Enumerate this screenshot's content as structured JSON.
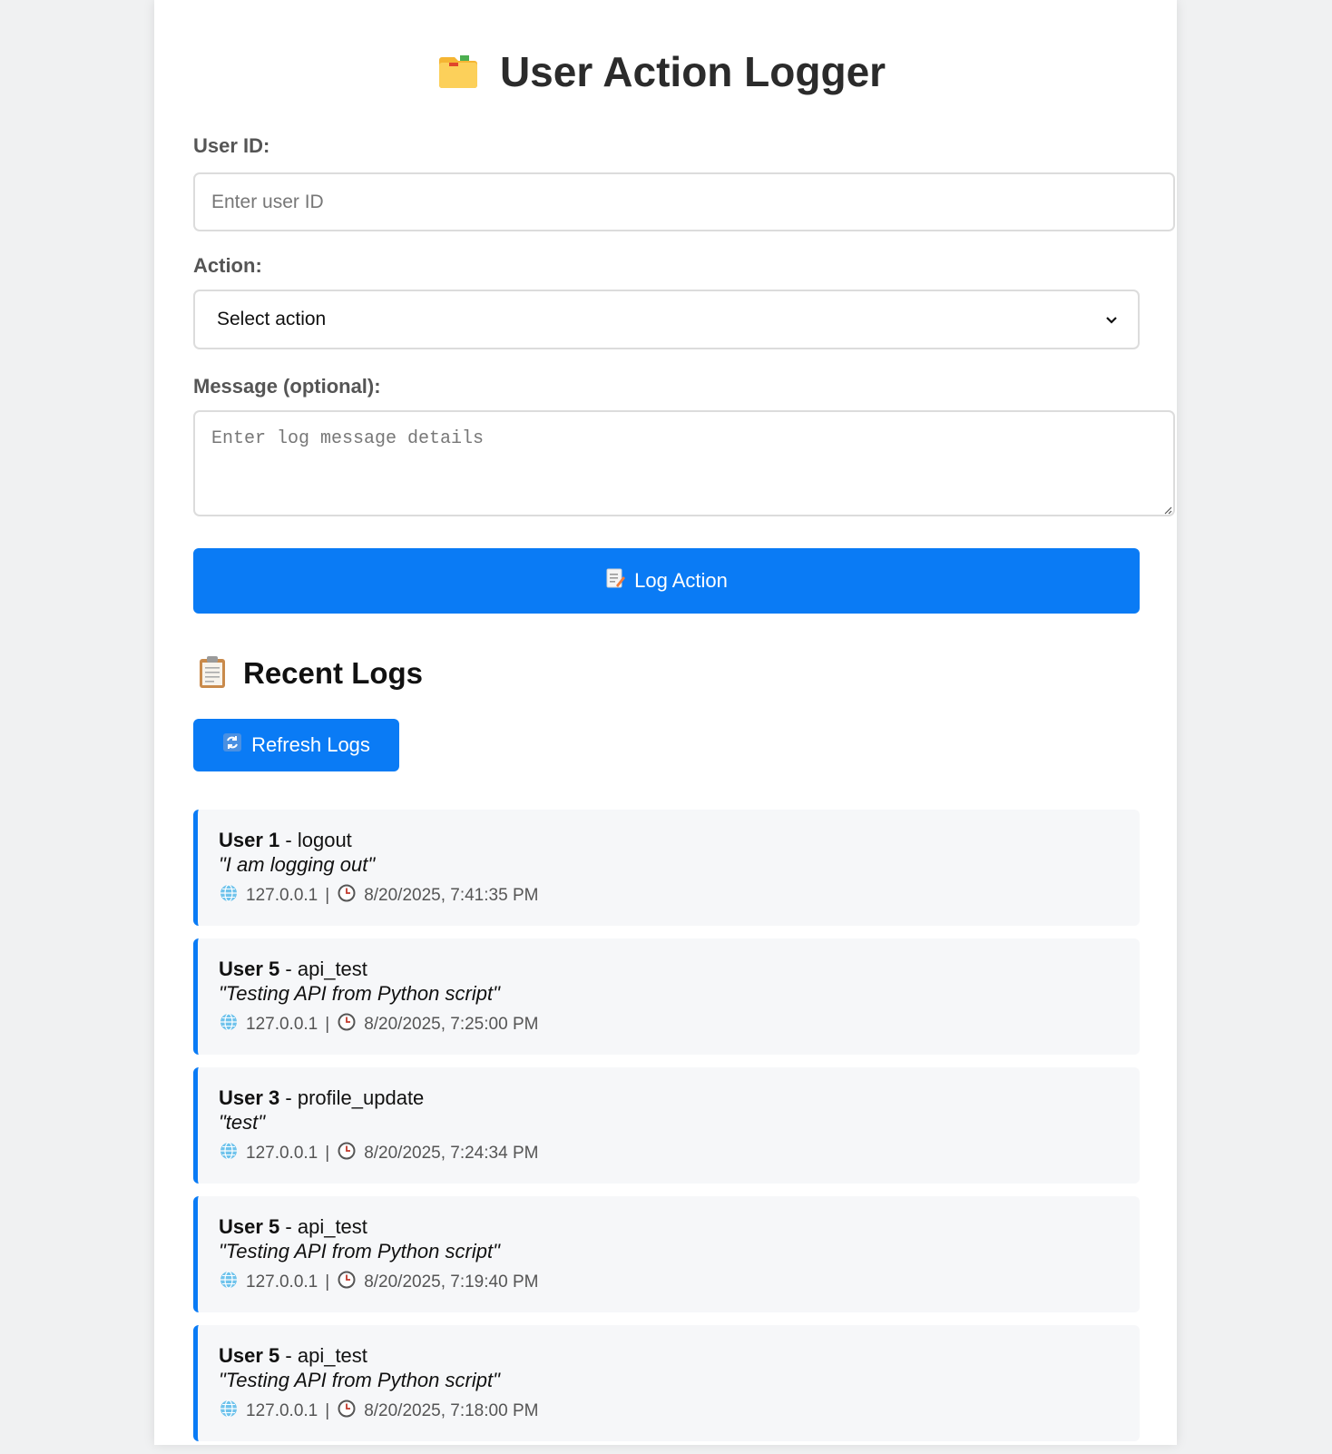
{
  "header": {
    "title": "User Action Logger",
    "icon": "folder-icon"
  },
  "form": {
    "user_id_label": "User ID:",
    "user_id_placeholder": "Enter user ID",
    "user_id_value": "",
    "action_label": "Action:",
    "action_selected": "Select action",
    "message_label": "Message (optional):",
    "message_placeholder": "Enter log message details",
    "message_value": "",
    "submit_label": "Log Action",
    "submit_icon": "memo-icon"
  },
  "logs_section": {
    "title": "Recent Logs",
    "icon": "clipboard-icon",
    "refresh_label": "Refresh Logs",
    "refresh_icon": "refresh-icon"
  },
  "logs": [
    {
      "user": "User 1",
      "action": "logout",
      "message": "\"I am logging out\"",
      "ip": "127.0.0.1",
      "separator": "|",
      "time": "8/20/2025, 7:41:35 PM"
    },
    {
      "user": "User 5",
      "action": "api_test",
      "message": "\"Testing API from Python script\"",
      "ip": "127.0.0.1",
      "separator": "|",
      "time": "8/20/2025, 7:25:00 PM"
    },
    {
      "user": "User 3",
      "action": "profile_update",
      "message": "\"test\"",
      "ip": "127.0.0.1",
      "separator": "|",
      "time": "8/20/2025, 7:24:34 PM"
    },
    {
      "user": "User 5",
      "action": "api_test",
      "message": "\"Testing API from Python script\"",
      "ip": "127.0.0.1",
      "separator": "|",
      "time": "8/20/2025, 7:19:40 PM"
    },
    {
      "user": "User 5",
      "action": "api_test",
      "message": "\"Testing API from Python script\"",
      "ip": "127.0.0.1",
      "separator": "|",
      "time": "8/20/2025, 7:18:00 PM"
    }
  ],
  "colors": {
    "accent": "#0a7bf5",
    "background": "#f0f1f2",
    "card": "#ffffff",
    "log_background": "#f6f7f9"
  }
}
